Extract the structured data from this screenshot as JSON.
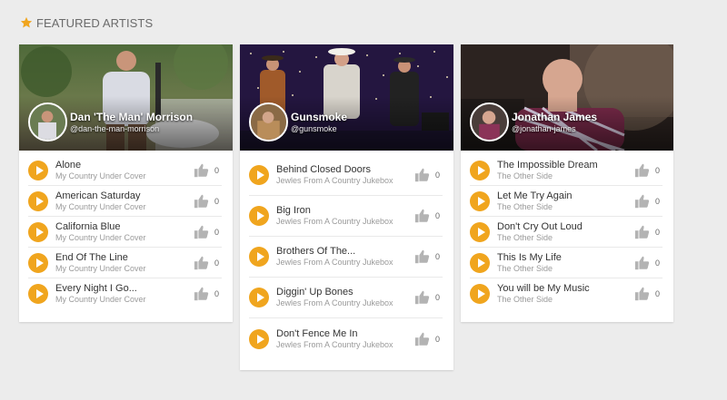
{
  "section": {
    "title": "FEATURED ARTISTS",
    "icon": "star-icon"
  },
  "colors": {
    "accent": "#f0a51e",
    "background": "#ececec",
    "card": "#ffffff"
  },
  "artists": [
    {
      "name": "Dan 'The Man' Morrison",
      "handle": "@dan-the-man-morrison",
      "tracks": [
        {
          "title": "Alone",
          "subtitle": "My Country Under Cover",
          "likes": "0"
        },
        {
          "title": "American Saturday",
          "subtitle": "My Country Under Cover",
          "likes": "0"
        },
        {
          "title": "California Blue",
          "subtitle": "My Country Under Cover",
          "likes": "0"
        },
        {
          "title": "End Of The Line",
          "subtitle": "My Country Under Cover",
          "likes": "0"
        },
        {
          "title": "Every Night I Go...",
          "subtitle": "My Country Under Cover",
          "likes": "0"
        }
      ]
    },
    {
      "name": "Gunsmoke",
      "handle": "@gunsmoke",
      "tracks": [
        {
          "title": "Behind Closed Doors",
          "subtitle": "Jewles From A Country Jukebox",
          "likes": "0"
        },
        {
          "title": "Big Iron",
          "subtitle": "Jewles From A Country Jukebox",
          "likes": "0"
        },
        {
          "title": "Brothers Of The...",
          "subtitle": "Jewles From A Country Jukebox",
          "likes": "0"
        },
        {
          "title": "Diggin' Up Bones",
          "subtitle": "Jewles From A Country Jukebox",
          "likes": "0"
        },
        {
          "title": "Don't Fence Me In",
          "subtitle": "Jewles From A Country Jukebox",
          "likes": "0"
        }
      ]
    },
    {
      "name": "Jonathan James",
      "handle": "@jonathan-james",
      "tracks": [
        {
          "title": "The Impossible Dream",
          "subtitle": "The Other Side",
          "likes": "0"
        },
        {
          "title": "Let Me Try Again",
          "subtitle": "The Other Side",
          "likes": "0"
        },
        {
          "title": "Don't Cry Out Loud",
          "subtitle": "The Other Side",
          "likes": "0"
        },
        {
          "title": "This Is My Life",
          "subtitle": "The Other Side",
          "likes": "0"
        },
        {
          "title": "You will be My Music",
          "subtitle": "The Other Side",
          "likes": "0"
        }
      ]
    }
  ]
}
